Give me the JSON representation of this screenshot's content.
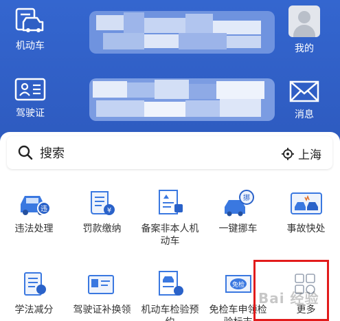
{
  "header": {
    "vehicle_label": "机动车",
    "license_label": "驾驶证",
    "mine_label": "我的",
    "message_label": "消息"
  },
  "search": {
    "placeholder": "搜索",
    "location": "上海"
  },
  "services": [
    {
      "label": "违法处理",
      "icon": "car-violation-icon"
    },
    {
      "label": "罚款缴纳",
      "icon": "fine-receipt-icon"
    },
    {
      "label": "备案非本人机动车",
      "icon": "register-vehicle-icon"
    },
    {
      "label": "一键挪车",
      "icon": "move-car-icon"
    },
    {
      "label": "事故快处",
      "icon": "accident-icon"
    },
    {
      "label": "学法减分",
      "icon": "study-icon"
    },
    {
      "label": "驾驶证补换领",
      "icon": "license-replace-icon"
    },
    {
      "label": "机动车检验预约",
      "icon": "inspection-booking-icon"
    },
    {
      "label": "免检车申领检验标志",
      "icon": "exempt-sticker-icon"
    },
    {
      "label": "更多",
      "icon": "more-icon"
    }
  ],
  "watermark": "Bai 经验",
  "colors": {
    "brand": "#2f5fc4",
    "accent": "#3a78e0",
    "highlight": "#e21b1b"
  }
}
